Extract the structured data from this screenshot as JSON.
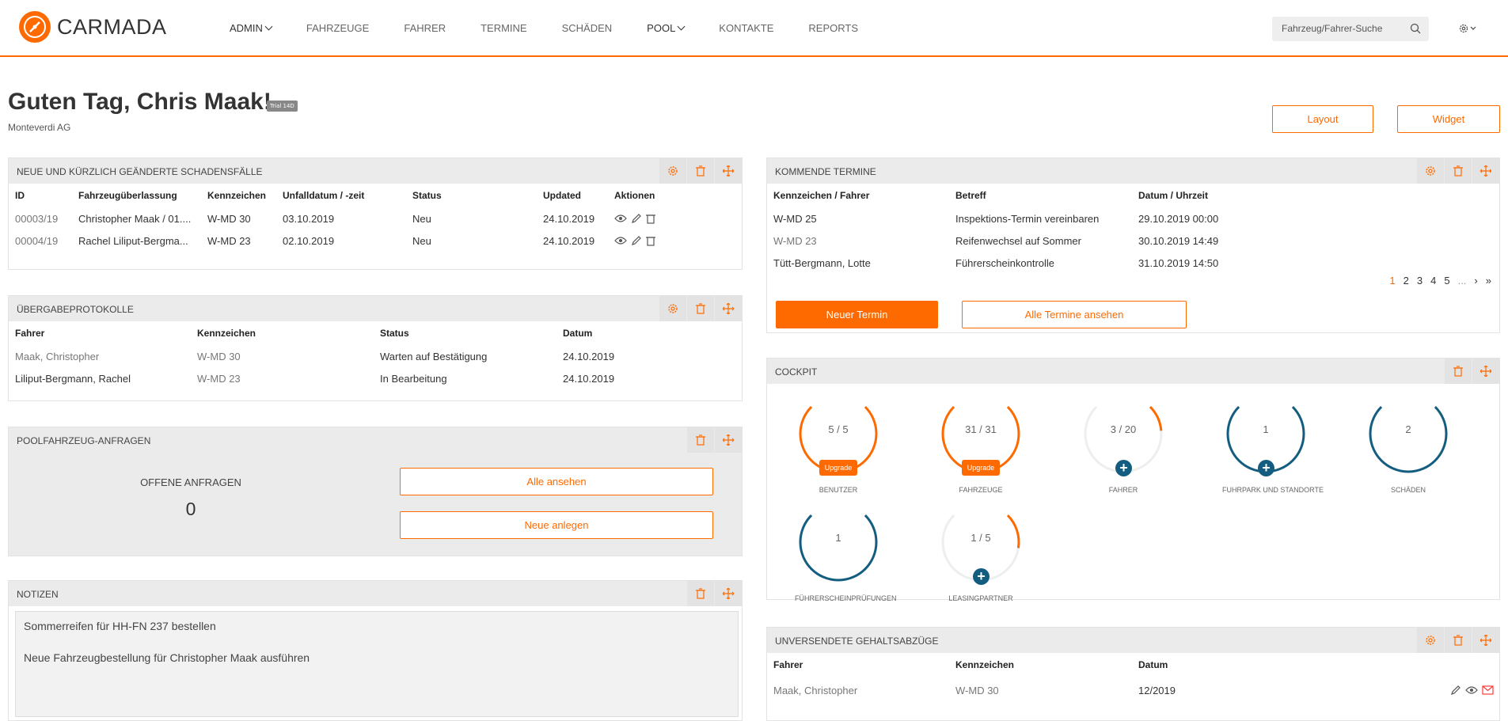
{
  "app": {
    "logo": "CARMADA"
  },
  "nav": [
    "ADMIN",
    "FAHRZEUGE",
    "FAHRER",
    "TERMINE",
    "SCHÄDEN",
    "POOL",
    "KONTAKTE",
    "REPORTS"
  ],
  "search": {
    "placeholder": "Fahrzeug/Fahrer-Suche"
  },
  "greeting": "Guten Tag, Chris Maak!",
  "trial": "Trial 14D",
  "company": "Monteverdi AG",
  "buttons": {
    "layout": "Layout",
    "widget": "Widget"
  },
  "schaden": {
    "title": "Neue und kürzlich geänderte Schadensfälle",
    "headers": [
      "ID",
      "Fahrzeugüberlassung",
      "Kennzeichen",
      "Unfalldatum / -zeit",
      "Status",
      "Updated",
      "Aktionen"
    ],
    "rows": [
      [
        "00003/19",
        "Christopher Maak / 01....",
        "W-MD 30",
        "03.10.2019",
        "Neu",
        "24.10.2019"
      ],
      [
        "00004/19",
        "Rachel Liliput-Bergma...",
        "W-MD 23",
        "02.10.2019",
        "Neu",
        "24.10.2019"
      ]
    ]
  },
  "uebergabe": {
    "title": "Übergabeprotokolle",
    "headers": [
      "Fahrer",
      "Kennzeichen",
      "Status",
      "Datum"
    ],
    "rows": [
      [
        "Maak, Christopher",
        "W-MD 30",
        "Warten auf Bestätigung",
        "24.10.2019"
      ],
      [
        "Liliput-Bergmann, Rachel",
        "W-MD 23",
        "In Bearbeitung",
        "24.10.2019"
      ]
    ]
  },
  "pool": {
    "title": "Poolfahrzeug-Anfragen",
    "label": "OFFENE ANFRAGEN",
    "count": "0",
    "btn_all": "Alle ansehen",
    "btn_new": "Neue anlegen"
  },
  "notizen": {
    "title": "Notizen",
    "lines": [
      "Sommerreifen für HH-FN 237 bestellen",
      "Neue Fahrzeugbestellung für Christopher Maak ausführen"
    ]
  },
  "termine": {
    "title": "Kommende Termine",
    "headers": [
      "Kennzeichen / Fahrer",
      "Betreff",
      "Datum / Uhrzeit"
    ],
    "rows": [
      [
        "W-MD 25",
        "Inspektions-Termin vereinbaren",
        "29.10.2019 00:00"
      ],
      [
        "W-MD 23",
        "Reifenwechsel auf Sommer",
        "30.10.2019 14:49"
      ],
      [
        "Tütt-Bergmann, Lotte",
        "Führerscheinkontrolle",
        "31.10.2019 14:50"
      ]
    ],
    "pages": [
      "1",
      "2",
      "3",
      "4",
      "5",
      "..."
    ],
    "btn_new": "Neuer Termin",
    "btn_all": "Alle Termine ansehen"
  },
  "cockpit": {
    "title": "Cockpit",
    "gauges": [
      {
        "value": "5 / 5",
        "label": "BENUTZER",
        "fill": 1.0,
        "color": "#ff6a00",
        "badge": "Upgrade"
      },
      {
        "value": "31 / 31",
        "label": "FAHRZEUGE",
        "fill": 1.0,
        "color": "#ff6a00",
        "badge": "Upgrade"
      },
      {
        "value": "3 / 20",
        "label": "FAHRER",
        "fill": 0.15,
        "color": "#ff6a00",
        "plus": true
      },
      {
        "value": "1",
        "label": "FUHRPARK UND STANDORTE",
        "fill": 1.0,
        "color": "#135e80",
        "plus": true
      },
      {
        "value": "2",
        "label": "SCHÄDEN",
        "fill": 1.0,
        "color": "#135e80"
      },
      {
        "value": "1",
        "label": "FÜHRERSCHEINPRÜFUNGEN",
        "fill": 1.0,
        "color": "#135e80"
      },
      {
        "value": "1 / 5",
        "label": "LEASINGPARTNER",
        "fill": 0.2,
        "color": "#ff6a00",
        "plus": true
      }
    ]
  },
  "gehalt": {
    "title": "Unversendete Gehaltsabzüge",
    "headers": [
      "Fahrer",
      "Kennzeichen",
      "Datum"
    ],
    "rows": [
      [
        "Maak, Christopher",
        "W-MD 30",
        "12/2019"
      ]
    ]
  }
}
